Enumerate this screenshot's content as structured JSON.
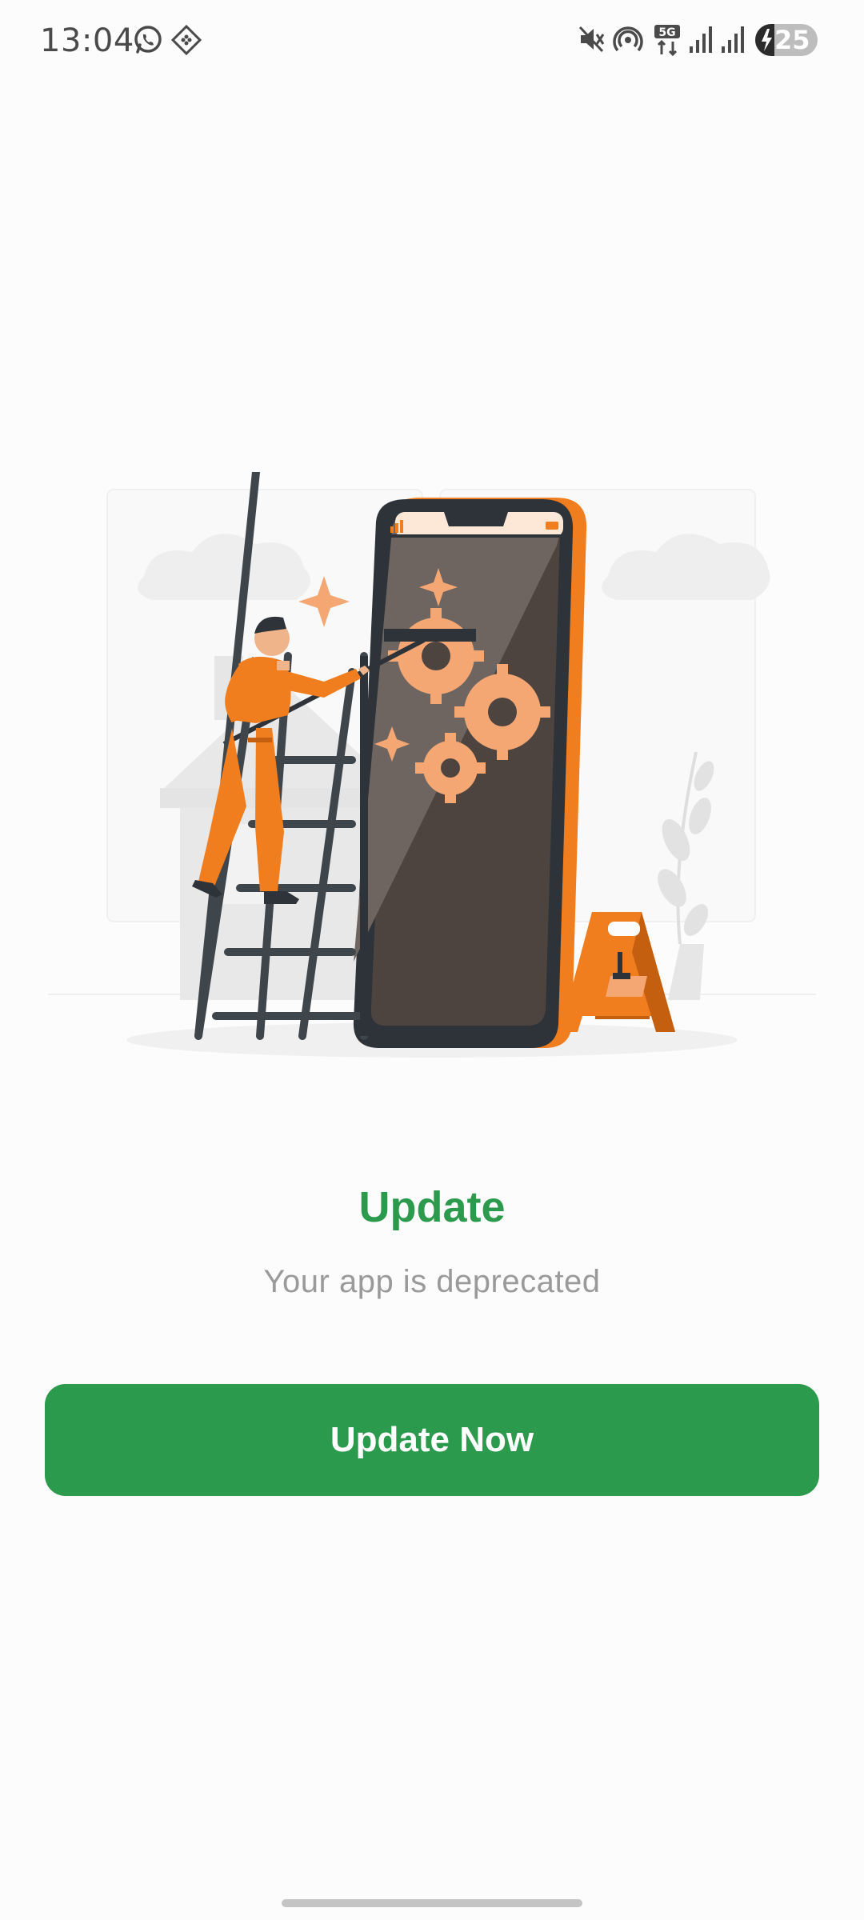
{
  "status_bar": {
    "time": "13:04",
    "left_icons": [
      "whatsapp-icon",
      "app-grid-icon"
    ],
    "right_icons": [
      "mute-icon",
      "hotspot-icon",
      "network-5g-icon",
      "signal-1-icon",
      "signal-2-icon",
      "battery-charging-icon"
    ],
    "network_label": "5G",
    "battery_level": "25"
  },
  "illustration": {
    "description_icon": "maintenance-illustration-icon",
    "accent_color": "#f07d1e",
    "phone_screen_color": "#4d4440"
  },
  "content": {
    "title": "Update",
    "subtitle": "Your app is deprecated",
    "button_label": "Update Now"
  },
  "colors": {
    "brand_green": "#2b9a4c",
    "subtitle_gray": "#9a9a9a",
    "background": "#fcfcfc"
  }
}
